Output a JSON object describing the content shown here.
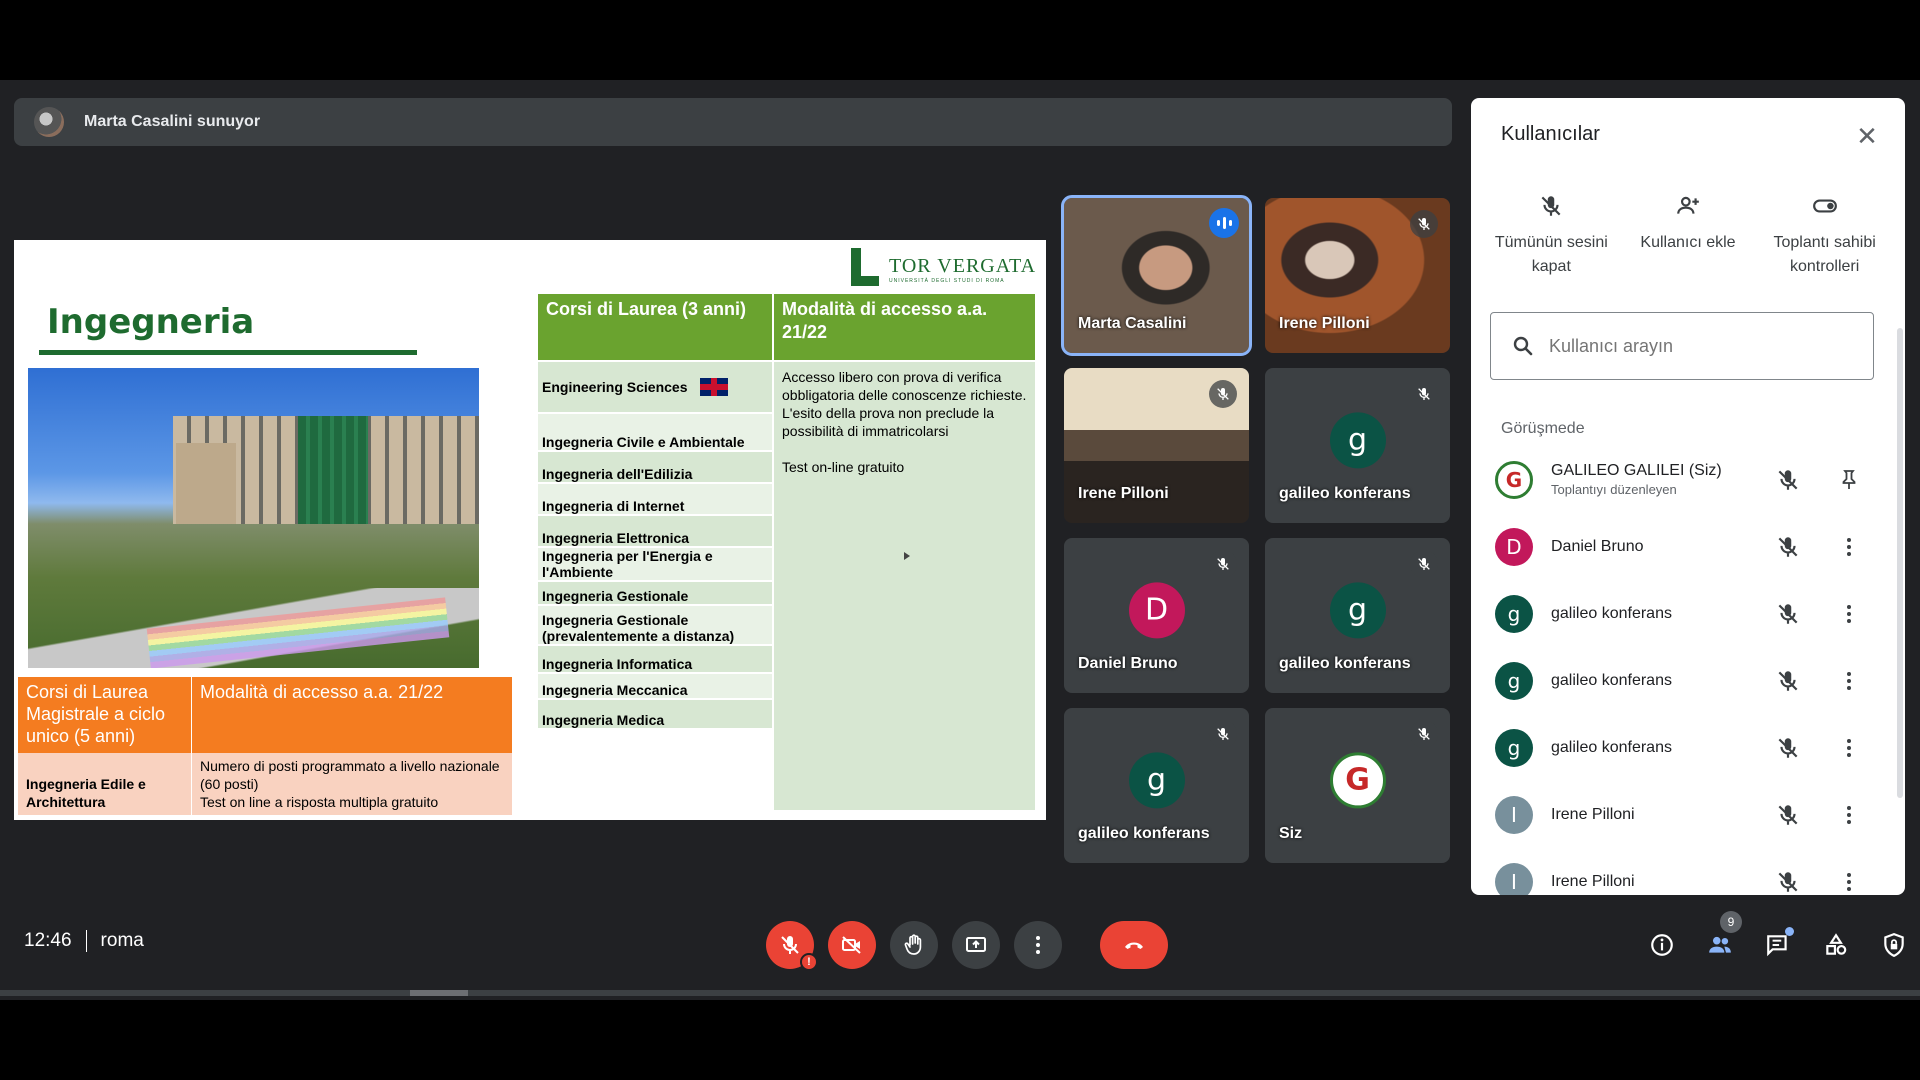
{
  "presenter": {
    "text": "Marta Casalini sunuyor"
  },
  "slide": {
    "title": "Ingegneria",
    "logo_name": "TOR VERGATA",
    "logo_sub": "UNIVERSITÀ DEGLI STUDI DI ROMA",
    "left_table": {
      "header_col1": "Corsi di Laurea Magistrale a ciclo unico (5 anni)",
      "header_col2": "Modalità di accesso a.a. 21/22",
      "row_col1": "Ingegneria Edile e Architettura",
      "row_col2": "Numero di posti programmato a livello nazionale (60 posti)\nTest on line a risposta multipla gratuito"
    },
    "right_table": {
      "header_col1": "Corsi di Laurea (3 anni)",
      "header_col2": "Modalità di accesso a.a. 21/22",
      "courses": [
        "Engineering Sciences",
        "Ingegneria Civile e Ambientale",
        "Ingegneria dell'Edilizia",
        "Ingegneria di Internet",
        "Ingegneria Elettronica",
        "Ingegneria per l'Energia e l'Ambiente",
        "Ingegneria Gestionale",
        "Ingegneria Gestionale (prevalentemente a distanza)",
        "Ingegneria Informatica",
        "Ingegneria Meccanica",
        "Ingegneria Medica"
      ],
      "access_text_1": "Accesso libero con prova di verifica obbligatoria delle conoscenze richieste. L'esito della prova non preclude la possibilità di immatricolarsi",
      "access_text_2": "Test on-line gratuito"
    }
  },
  "tiles": [
    {
      "name": "Marta Casalini",
      "type": "video",
      "speaking": true
    },
    {
      "name": "Irene Pilloni",
      "type": "video",
      "muted": true
    },
    {
      "name": "Irene Pilloni",
      "type": "video",
      "muted": true
    },
    {
      "name": "galileo konferans",
      "initial": "g",
      "color": "#0b5345",
      "muted": true
    },
    {
      "name": "Daniel Bruno",
      "initial": "D",
      "color": "#c2185b",
      "muted": true
    },
    {
      "name": "galileo konferans",
      "initial": "g",
      "color": "#0b5345",
      "muted": true
    },
    {
      "name": "galileo konferans",
      "initial": "g",
      "color": "#0b5345",
      "muted": true
    },
    {
      "name": "Siz",
      "type": "logo",
      "muted": true
    }
  ],
  "panel": {
    "title": "Kullanıcılar",
    "actions": [
      {
        "label": "Tümünün sesini kapat",
        "icon": "mic-off-icon"
      },
      {
        "label": "Kullanıcı ekle",
        "icon": "add-person-icon"
      },
      {
        "label": "Toplantı sahibi kontrolleri",
        "icon": "toggle-icon"
      }
    ],
    "search_placeholder": "Kullanıcı arayın",
    "section": "Görüşmede",
    "people": [
      {
        "name": "GALILEO GALILEI (Siz)",
        "role": "Toplantıyı düzenleyen",
        "initial": "G",
        "color": "#ffffff",
        "logo": true
      },
      {
        "name": "Daniel Bruno",
        "initial": "D",
        "color": "#c2185b"
      },
      {
        "name": "galileo konferans",
        "initial": "g",
        "color": "#0b5345"
      },
      {
        "name": "galileo konferans",
        "initial": "g",
        "color": "#0b5345"
      },
      {
        "name": "galileo konferans",
        "initial": "g",
        "color": "#0b5345"
      },
      {
        "name": "Irene Pilloni",
        "initial": "I",
        "color": "#78909c"
      },
      {
        "name": "Irene Pilloni",
        "initial": "I",
        "color": "#78909c"
      }
    ]
  },
  "bottom": {
    "time": "12:46",
    "meeting": "roma",
    "participants_count": "9"
  }
}
